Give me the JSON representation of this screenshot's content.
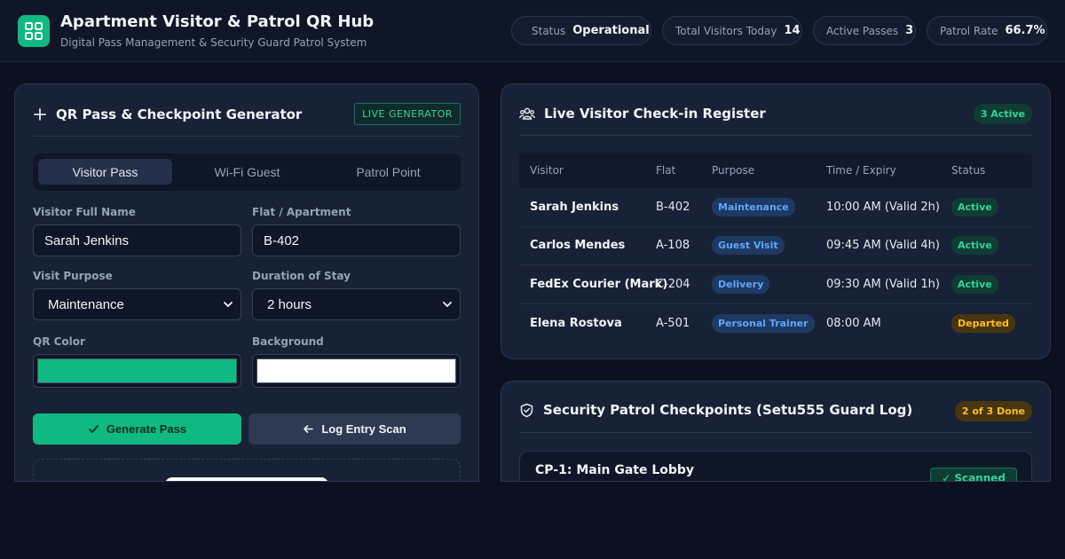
{
  "header": {
    "title": "Apartment Visitor & Patrol QR Hub",
    "subtitle": "Digital Pass Management & Security Guard Patrol System",
    "logo_icon": "grid-icon",
    "stats": [
      {
        "label": "Status",
        "value": "Operational"
      },
      {
        "label": "Total Visitors Today",
        "value": "14"
      },
      {
        "label": "Active Passes",
        "value": "3"
      },
      {
        "label": "Patrol Rate",
        "value": "66.7%"
      }
    ]
  },
  "generator": {
    "title": "QR Pass & Checkpoint Generator",
    "badge": "LIVE GENERATOR",
    "tabs": [
      {
        "label": "Visitor Pass",
        "active": true
      },
      {
        "label": "Wi-Fi Guest",
        "active": false
      },
      {
        "label": "Patrol Point",
        "active": false
      }
    ],
    "fields": {
      "name_label": "Visitor Full Name",
      "name_value": "Sarah Jenkins",
      "flat_label": "Flat / Apartment",
      "flat_value": "B-402",
      "purpose_label": "Visit Purpose",
      "purpose_value": "Maintenance",
      "duration_label": "Duration of Stay",
      "duration_value": "2 hours",
      "qr_color_label": "QR Color",
      "qr_color": "#10b981",
      "bg_label": "Background",
      "bg_color": "#ffffff"
    },
    "buttons": {
      "generate": "Generate Pass",
      "log": "Log Entry Scan"
    }
  },
  "register": {
    "title": "Live Visitor Check-in Register",
    "badge": "3 Active",
    "columns": [
      "Visitor",
      "Flat",
      "Purpose",
      "Time / Expiry",
      "Status"
    ],
    "rows": [
      {
        "visitor": "Sarah Jenkins",
        "flat": "B-402",
        "purpose": "Maintenance",
        "time": "10:00 AM (Valid 2h)",
        "status": "Active"
      },
      {
        "visitor": "Carlos Mendes",
        "flat": "A-108",
        "purpose": "Guest Visit",
        "time": "09:45 AM (Valid 4h)",
        "status": "Active"
      },
      {
        "visitor": "FedEx Courier (Mark)",
        "flat": "C-204",
        "purpose": "Delivery",
        "time": "09:30 AM (Valid 1h)",
        "status": "Active"
      },
      {
        "visitor": "Elena Rostova",
        "flat": "A-501",
        "purpose": "Personal Trainer",
        "time": "08:00 AM",
        "status": "Departed"
      }
    ]
  },
  "patrol": {
    "title": "Security Patrol Checkpoints (Setu555 Guard Log)",
    "badge": "2 of 3 Done",
    "checkpoints": [
      {
        "name": "CP-1: Main Gate Lobby",
        "status": "✓ Scanned"
      }
    ]
  },
  "colors": {
    "accent": "#10b981",
    "background": "#0b1120",
    "panel": "#182236",
    "warning": "#fbbf24",
    "info": "#60a5fa"
  }
}
